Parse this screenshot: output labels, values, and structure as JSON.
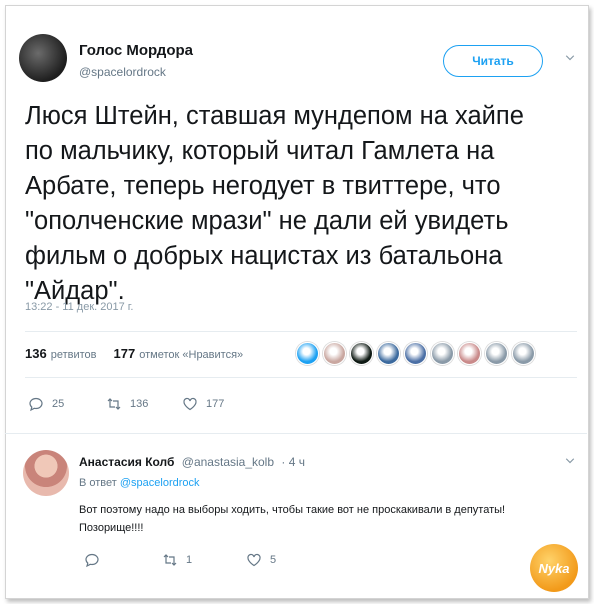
{
  "tweet": {
    "author_name": "Голос Мордора",
    "author_handle": "@spacelordrock",
    "follow_label": "Читать",
    "text": "Люся Штейн, ставшая мундепом на хайпе\nпо мальчику, который читал Гамлета на\nАрбате, теперь негодует в твиттере, что\n\"ополченские мрази\" не дали ей увидеть\nфильм о добрых нацистах из батальона\n\"Айдар\".",
    "timestamp": "13:22 - 11 дек. 2017 г.",
    "retweets_count": "136",
    "retweets_label": "ретвитов",
    "likes_count": "177",
    "likes_label": "отметок «Нравится»",
    "liker_colors": [
      "#1da1f2",
      "#c9a7a0",
      "#0f1a14",
      "#3c6a9e",
      "#4b6fa5",
      "#8a9aa8",
      "#c98a8a",
      "#8a9aa8",
      "#8a9aa8"
    ],
    "actions": {
      "replies": "25",
      "retweets": "136",
      "likes": "177"
    }
  },
  "reply": {
    "author_name": "Анастасия Колб",
    "author_handle": "@anastasia_kolb",
    "time": "· 4 ч",
    "reply_to_prefix": "В ответ",
    "reply_to_handle": "@spacelordrock",
    "text": "Вот поэтому надо на выборы ходить, чтобы такие вот не проскакивали в депутаты!Позорище!!!!",
    "actions": {
      "replies": "",
      "retweets": "1",
      "likes": "5"
    }
  },
  "watermark": "Nyka"
}
